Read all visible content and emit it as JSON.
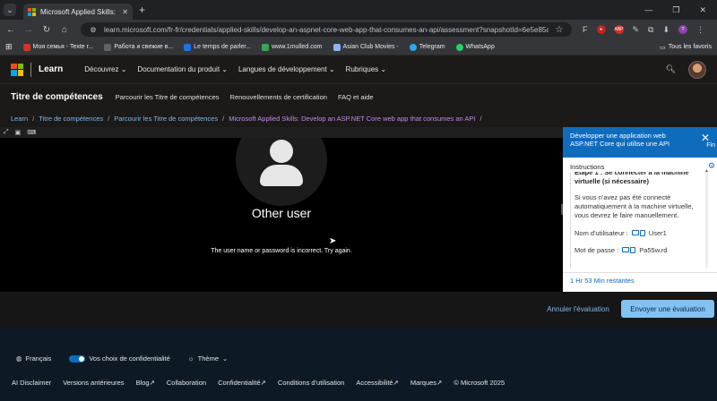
{
  "browser": {
    "tab_title": "Microsoft Applied Skills: Develo",
    "url": "learn.microsoft.com/fr-fr/credentials/applied-skills/develop-an-aspnet-core-web-app-that-consumes-an-api/assessment?snapshotId=6e5e85a3-0164-46c...",
    "bookmarks": [
      {
        "label": "Моя семья - Texte r...",
        "color": "#d93025"
      },
      {
        "label": "Работа и свежие в...",
        "color": "#5f6368"
      },
      {
        "label": "Le temps de parler...",
        "color": "#1a73e8"
      },
      {
        "label": "www.1mulled.com",
        "color": "#34a853"
      },
      {
        "label": "Asian Club Movies -",
        "color": "#8ab4f8"
      },
      {
        "label": "Telegram",
        "color": "#29a9eb"
      },
      {
        "label": "WhatsApp",
        "color": "#25d366"
      }
    ],
    "bookmarks_folder": "Tous les favoris"
  },
  "nav": {
    "brand": "Learn",
    "items": [
      "Découvrez",
      "Documentation du produit",
      "Langues de développement",
      "Rubriques"
    ]
  },
  "subnav": {
    "title": "Titre de compétences",
    "links": [
      "Parcourir les Titre de compétences",
      "Renouvellements de certification",
      "FAQ et aide"
    ]
  },
  "breadcrumb": [
    "Learn",
    "Titre de compétences",
    "Parcourir les Titre de compétences",
    "Microsoft Applied Skills: Develop an ASP.NET Core web app that consumes an API"
  ],
  "vm": {
    "user_label": "Other user",
    "error_message": "The user name or password is incorrect. Try again."
  },
  "panel": {
    "title": "Développer une application web ASP.NET Core qui utilise une API",
    "finish": "Fin",
    "tab": "Instructions",
    "step_heading": "Étape 1 : Se connecter à la machine virtuelle (si nécessaire)",
    "step_text": "Si vous n'avez pas été connecté automatiquement à la machine virtuelle, vous devrez le faire manuellement.",
    "username_label": "Nom d'utilisateur :",
    "username_value": "User1",
    "password_label": "Mot de passe :",
    "password_value": "Pa55w.rd",
    "time_remaining": "1 Hr 53 Min restantes"
  },
  "actions": {
    "cancel": "Annuler l'évaluation",
    "submit": "Envoyer une évaluation"
  },
  "footer": {
    "language": "Français",
    "privacy": "Vos choix de confidentialité",
    "theme": "Thème",
    "links": [
      "AI Disclaimer",
      "Versions antérieures",
      "Blog",
      "Collaboration",
      "Confidentialité",
      "Conditions d'utilisation",
      "Accessibilité",
      "Marques",
      "© Microsoft 2025"
    ]
  }
}
